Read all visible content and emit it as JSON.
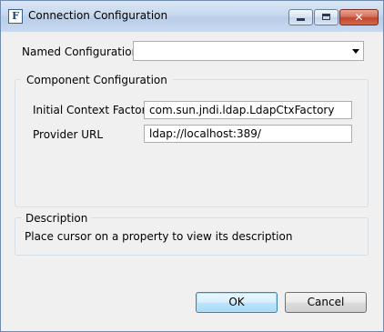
{
  "window": {
    "title": "Connection Configuration",
    "app_icon_letter": "F",
    "close_symbol": "✕"
  },
  "named_config": {
    "label": "Named Configuration",
    "value": ""
  },
  "component_config": {
    "legend": "Component Configuration",
    "initial_context_factory": {
      "label": "Initial Context Factory",
      "value": "com.sun.jndi.ldap.LdapCtxFactory"
    },
    "provider_url": {
      "label": "Provider URL",
      "value": "ldap://localhost:389/"
    }
  },
  "description": {
    "legend": "Description",
    "text": "Place cursor on a property to view its description"
  },
  "buttons": {
    "ok": "OK",
    "cancel": "Cancel"
  }
}
